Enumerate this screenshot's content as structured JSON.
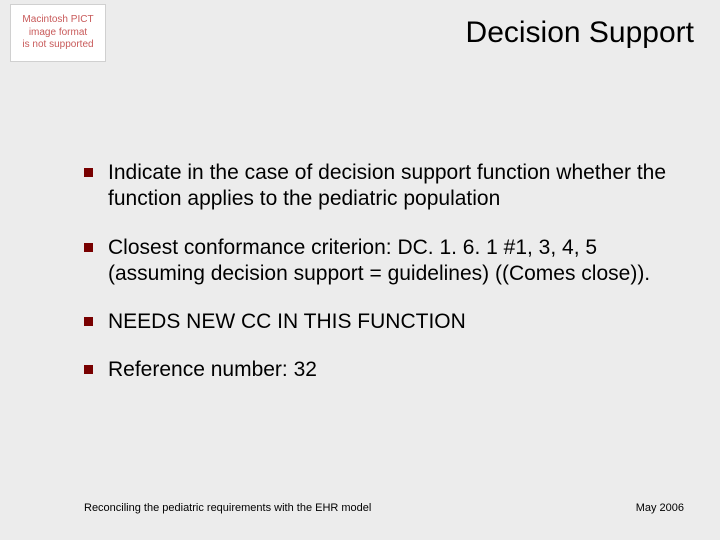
{
  "placeholder": {
    "line1": "Macintosh PICT",
    "line2": "image format",
    "line3": "is not supported"
  },
  "title": "Decision Support",
  "bullets": [
    "Indicate in the case of  decision support function whether the function applies to the pediatric population",
    "Closest conformance criterion: DC. 1. 6. 1 #1, 3, 4, 5 (assuming decision support = guidelines) ((Comes close)).",
    "NEEDS NEW CC IN THIS FUNCTION",
    "Reference number: 32"
  ],
  "footer": {
    "left": "Reconciling the pediatric requirements with the EHR model",
    "right": "May 2006"
  }
}
